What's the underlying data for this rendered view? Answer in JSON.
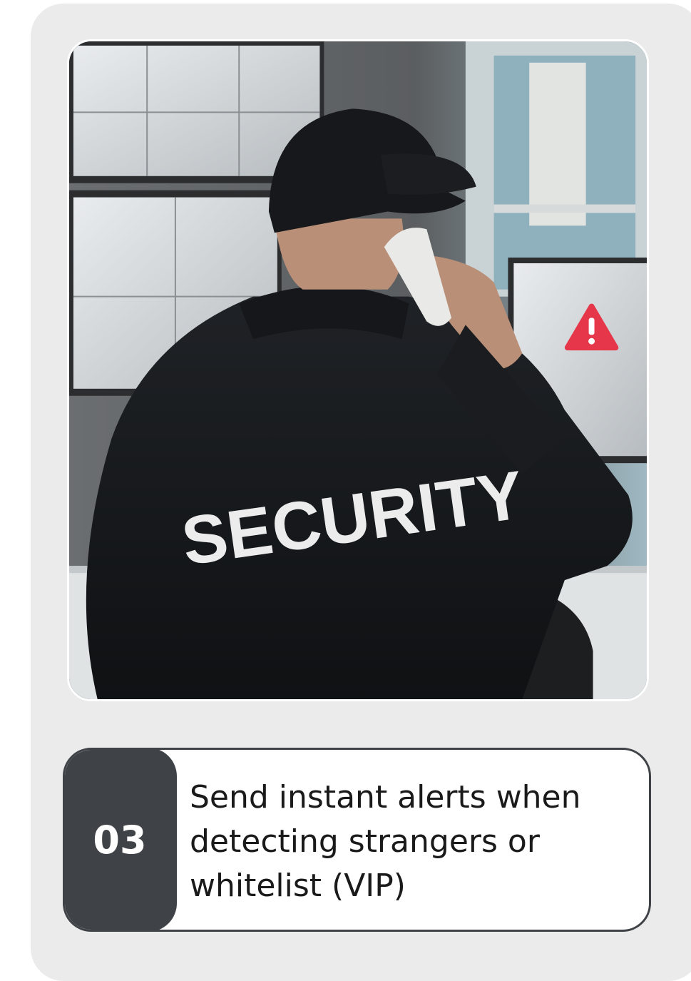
{
  "photo": {
    "jacket_lettering": "SECURITY",
    "alert_icon": "warning-triangle-icon",
    "alert_color": "#e5364a"
  },
  "step": {
    "number": "03",
    "description": "Send instant alerts when detecting strangers or whitelist (VIP)"
  },
  "colors": {
    "card_background": "#ebebeb",
    "badge_background": "#3f4347",
    "caption_border": "#3f4347"
  }
}
